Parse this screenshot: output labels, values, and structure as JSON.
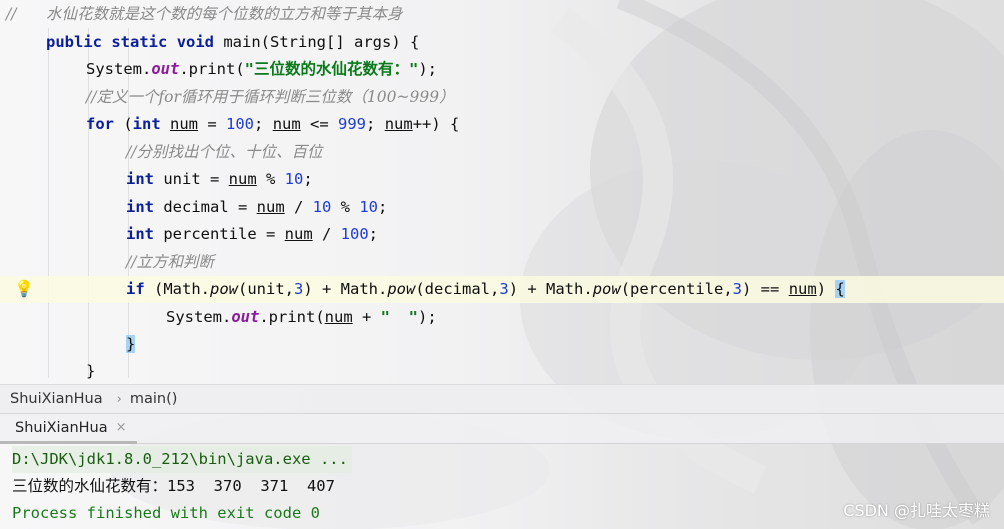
{
  "code_lines": {
    "l1_comment": "//      水仙花数就是这个数的每个位数的立方和等于其本身",
    "l2_public": "public",
    "l2_static": "static",
    "l2_void": "void",
    "l2_rest": " main(String[] args) {",
    "l3_pre": "System.",
    "l3_field": "out",
    "l3_mid": ".print(",
    "l3_str": "\"三位数的水仙花数有：\"",
    "l3_end": ");",
    "l4_comment": "//定义一个for循环用于循环判断三位数（100~999）",
    "l5_for": "for",
    "l5_a": " (",
    "l5_int": "int",
    "l5_b": " ",
    "l5_num1": "num",
    "l5_c": " = ",
    "l5_n100": "100",
    "l5_d": "; ",
    "l5_num2": "num",
    "l5_e": " <= ",
    "l5_n999": "999",
    "l5_f": "; ",
    "l5_num3": "num",
    "l5_g": "++) {",
    "l6_comment": "//分别找出个位、十位、百位",
    "l7_int": "int",
    "l7_a": " unit = ",
    "l7_num": "num",
    "l7_b": " % ",
    "l7_n10": "10",
    "l7_c": ";",
    "l8_int": "int",
    "l8_a": " decimal = ",
    "l8_num": "num",
    "l8_b": " / ",
    "l8_n10a": "10",
    "l8_c": " % ",
    "l8_n10b": "10",
    "l8_d": ";",
    "l9_int": "int",
    "l9_a": " percentile = ",
    "l9_num": "num",
    "l9_b": " / ",
    "l9_n100": "100",
    "l9_c": ";",
    "l10_comment": "//立方和判断",
    "l11_if": "if",
    "l11_a": " (Math.",
    "l11_pow1": "pow",
    "l11_b": "(unit,",
    "l11_n3a": "3",
    "l11_c": ") + Math.",
    "l11_pow2": "pow",
    "l11_d": "(decimal,",
    "l11_n3b": "3",
    "l11_e": ") + Math.",
    "l11_pow3": "pow",
    "l11_f": "(percentile,",
    "l11_n3c": "3",
    "l11_g": ") == ",
    "l11_num": "num",
    "l11_h": ") ",
    "l11_brace": "{",
    "l12_pre": "System.",
    "l12_field": "out",
    "l12_mid": ".print(",
    "l12_num": "num",
    "l12_plus": " + ",
    "l12_str": "\"  \"",
    "l12_end": ");",
    "l13_brace": "}",
    "l14_brace": "}"
  },
  "breadcrumb": {
    "class_name": "ShuiXianHua",
    "separator": "›",
    "method": "main()"
  },
  "run_tab": {
    "label": "ShuiXianHua",
    "close": "×"
  },
  "console": {
    "command": "D:\\JDK\\jdk1.8.0_212\\bin\\java.exe ...",
    "output": "三位数的水仙花数有：153  370  371  407",
    "exit": "Process finished with exit code 0"
  },
  "watermark": "CSDN @扎哇太枣糕",
  "colors": {
    "keyword": "#0b1f9a",
    "string": "#087a1a",
    "comment": "#8a8a8a",
    "number": "#1f3bd6",
    "field": "#8a1e9a"
  }
}
